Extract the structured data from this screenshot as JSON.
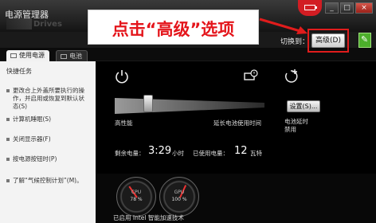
{
  "window": {
    "title": "电源管理器",
    "logo_text": "Drives"
  },
  "annotation": {
    "text": "点击“高级”选项"
  },
  "titlebar_buttons": [
    {
      "name": "minimize",
      "glyph": "_"
    },
    {
      "name": "maximize",
      "glyph": "□"
    },
    {
      "name": "close",
      "glyph": "×"
    }
  ],
  "mode_switch": {
    "label": "切换到：",
    "button": "高级(D)"
  },
  "tabs": [
    {
      "label": "使用电源",
      "active": true
    },
    {
      "label": "电池",
      "active": false
    }
  ],
  "sidebar": {
    "heading": "快捷任务",
    "items": [
      "更改合上外盖所要执行的操作，并启用或恢复到默认状态(S)",
      "计算机睡眠(S)",
      "关闭显示器(F)",
      "按电源按钮时(P)",
      "了解“气候控制计划”(M)。"
    ]
  },
  "main": {
    "icons": [
      "power-icon",
      "battery-clock-icon",
      "timer-plus-icon"
    ],
    "slider_left_label": "高性能",
    "slider_right_label": "延长电池使用时间",
    "settings_button": "设置(S)...",
    "right_label_line1": "电池延时",
    "right_label_line2": "禁用",
    "stats": {
      "remaining_label": "剩余电量：",
      "remaining_value": "3:29",
      "remaining_unit": "小时",
      "used_label": "已使用电量：",
      "used_value": "12",
      "used_unit": "瓦特"
    }
  },
  "gauges": [
    {
      "label": "CPU",
      "value": "78 %"
    },
    {
      "label": "GPU",
      "value": "100 %"
    }
  ],
  "lower_text": "已启用 Intel 智能加速技术",
  "colors": {
    "accent_red": "#e4151b",
    "tray_red": "#d21d23",
    "leaf_green": "#4cae2b"
  }
}
